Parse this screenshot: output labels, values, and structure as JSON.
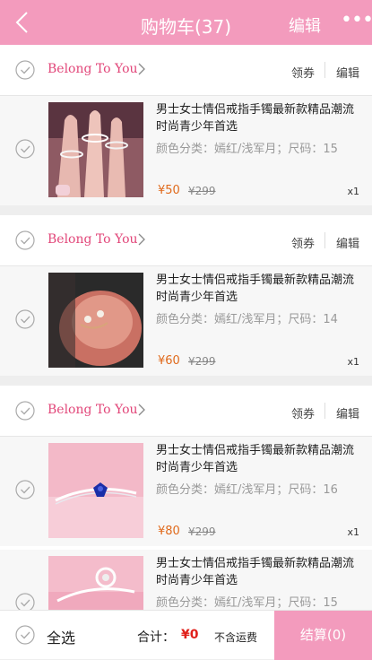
{
  "header": {
    "title": "购物车(37)",
    "edit_label": "编辑",
    "more_label": "•••"
  },
  "shops": [
    {
      "name": "Belong To You",
      "coupon": "领券",
      "edit": "编辑",
      "items": [
        {
          "title": "男士女士情侣戒指手镯最新款精品潮流时尚青少年首选",
          "attr": "颜色分类：嫣红/浅军月；尺码：15",
          "price": "¥50",
          "orig": "¥299",
          "qty": "x1"
        }
      ]
    },
    {
      "name": "Belong To You",
      "coupon": "领券",
      "edit": "编辑",
      "items": [
        {
          "title": "男士女士情侣戒指手镯最新款精品潮流时尚青少年首选",
          "attr": "颜色分类：嫣红/浅军月；尺码：14",
          "price": "¥60",
          "orig": "¥299",
          "qty": "x1"
        }
      ]
    },
    {
      "name": "Belong To You",
      "coupon": "领券",
      "edit": "编辑",
      "items": [
        {
          "title": "男士女士情侣戒指手镯最新款精品潮流时尚青少年首选",
          "attr": "颜色分类：嫣红/浅军月；尺码：16",
          "price": "¥80",
          "orig": "¥299",
          "qty": "x1"
        },
        {
          "title": "男士女士情侣戒指手镯最新款精品潮流时尚青少年首选",
          "attr": "颜色分类：嫣红/浅军月；尺码：15",
          "price": "",
          "orig": "",
          "qty": ""
        }
      ]
    }
  ],
  "footer": {
    "select_all": "全选",
    "total_label": "合计：",
    "total_value": "¥0",
    "shipping_note": "不含运费",
    "checkout_label": "结算(0)"
  },
  "colors": {
    "brand": "#f39bbd",
    "shop_name": "#e2477a",
    "price": "#e06a1c",
    "total": "#e0201a"
  }
}
